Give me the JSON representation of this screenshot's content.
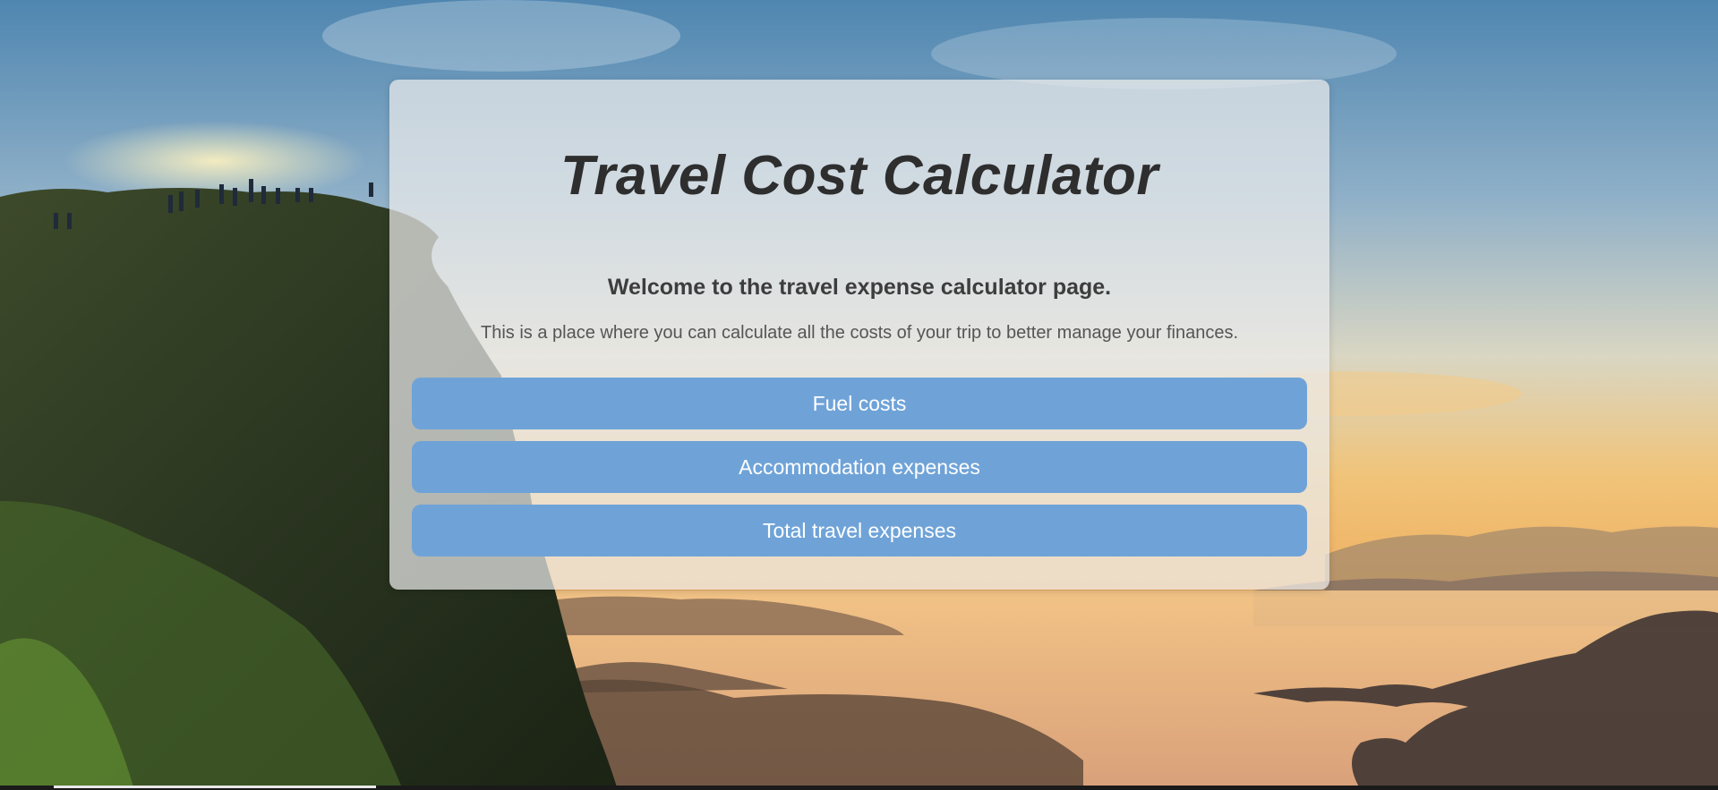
{
  "page": {
    "title": "Travel Cost Calculator",
    "welcome": "Welcome to the travel expense calculator page.",
    "description": "This is a place where you can calculate all the costs of your trip to better manage your finances."
  },
  "buttons": {
    "fuel": "Fuel costs",
    "accommodation": "Accommodation expenses",
    "total": "Total travel expenses"
  },
  "colors": {
    "button_bg": "#6fa3d8",
    "button_text": "#ffffff",
    "card_bg": "rgba(235,235,235,0.72)",
    "title_text": "#2e2e2e"
  },
  "background": {
    "scene": "mountain-cliff-sunrise-sea-of-clouds"
  }
}
